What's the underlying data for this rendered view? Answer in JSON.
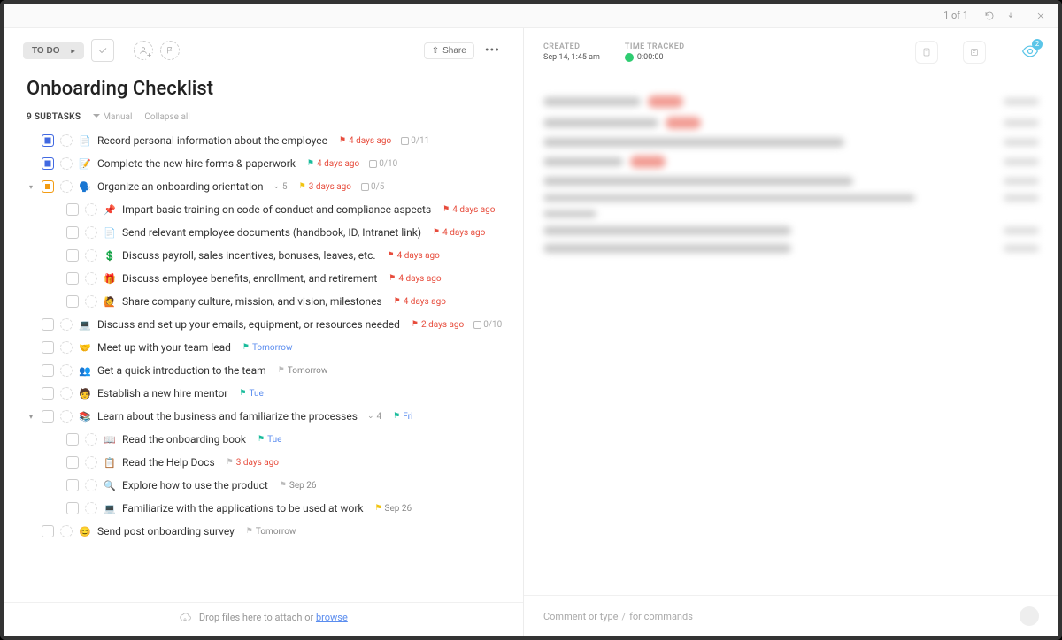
{
  "topbar": {
    "tabs": [
      "",
      "",
      ""
    ],
    "pager": "1 of 1"
  },
  "toolbar": {
    "status": "TO DO",
    "share": "Share"
  },
  "title": "Onboarding Checklist",
  "subtasks_header": {
    "count": "9 SUBTASKS",
    "manual": "Manual",
    "collapse": "Collapse all"
  },
  "tasks": [
    {
      "id": 0,
      "chk": "blue",
      "emoji": "📄",
      "title": "Record personal information about the employee",
      "flag": "red",
      "due": "4 days ago",
      "dueColor": "red",
      "progress": "0/11"
    },
    {
      "id": 1,
      "chk": "blue",
      "emoji": "📝",
      "title": "Complete the new hire forms & paperwork",
      "flag": "teal",
      "due": "4 days ago",
      "dueColor": "red",
      "progress": "0/10"
    },
    {
      "id": 2,
      "chk": "orange",
      "emoji": "🗣️",
      "title": "Organize an onboarding orientation",
      "subCount": 5,
      "flag": "yellow",
      "due": "3 days ago",
      "dueColor": "red",
      "progress": "0/5",
      "collapse": true
    },
    {
      "id": 3,
      "child": true,
      "emoji": "📌",
      "title": "Impart basic training on code of conduct and compliance aspects",
      "flag": "red",
      "due": "4 days ago",
      "dueColor": "red"
    },
    {
      "id": 4,
      "child": true,
      "emoji": "📄",
      "title": "Send relevant employee documents (handbook, ID, Intranet link)",
      "flag": "red",
      "due": "4 days ago",
      "dueColor": "red"
    },
    {
      "id": 5,
      "child": true,
      "emoji": "💲",
      "title": "Discuss payroll, sales incentives, bonuses, leaves, etc.",
      "flag": "red",
      "due": "4 days ago",
      "dueColor": "red"
    },
    {
      "id": 6,
      "child": true,
      "emoji": "🎁",
      "title": "Discuss employee benefits, enrollment, and retirement",
      "flag": "red",
      "due": "4 days ago",
      "dueColor": "red"
    },
    {
      "id": 7,
      "child": true,
      "emoji": "🙋",
      "title": "Share company culture, mission, and vision, milestones",
      "flag": "red",
      "due": "4 days ago",
      "dueColor": "red"
    },
    {
      "id": 8,
      "emoji": "💻",
      "title": "Discuss and set up your emails, equipment, or resources needed",
      "flag": "red",
      "due": "2 days ago",
      "dueColor": "red",
      "progress": "0/10"
    },
    {
      "id": 9,
      "emoji": "🤝",
      "title": "Meet up with your team lead",
      "flag": "teal",
      "due": "Tomorrow",
      "dueColor": "blue"
    },
    {
      "id": 10,
      "emoji": "👥",
      "title": "Get a quick introduction to the team",
      "flag": "grey",
      "due": "Tomorrow",
      "dueColor": "grey"
    },
    {
      "id": 11,
      "emoji": "🧑",
      "title": "Establish a new hire mentor",
      "flag": "teal",
      "due": "Tue",
      "dueColor": "blue"
    },
    {
      "id": 12,
      "emoji": "📚",
      "title": "Learn about the business and familiarize the processes",
      "subCount": 4,
      "flag": "teal",
      "due": "Fri",
      "dueColor": "blue",
      "collapse": true
    },
    {
      "id": 13,
      "child": true,
      "emoji": "📖",
      "title": "Read the onboarding book",
      "flag": "teal",
      "due": "Tue",
      "dueColor": "blue"
    },
    {
      "id": 14,
      "child": true,
      "emoji": "📋",
      "title": "Read the Help Docs",
      "flag": "grey",
      "due": "3 days ago",
      "dueColor": "red"
    },
    {
      "id": 15,
      "child": true,
      "emoji": "🔍",
      "title": "Explore how to use the product",
      "flag": "grey",
      "due": "Sep 26",
      "dueColor": "grey"
    },
    {
      "id": 16,
      "child": true,
      "emoji": "💻",
      "title": "Familiarize with the applications to be used at work",
      "flag": "yellow",
      "due": "Sep 26",
      "dueColor": "grey"
    },
    {
      "id": 17,
      "emoji": "😊",
      "title": "Send post onboarding survey",
      "flag": "grey",
      "due": "Tomorrow",
      "dueColor": "grey"
    }
  ],
  "dropzone": {
    "text": "Drop files here to attach or ",
    "link": "browse"
  },
  "right": {
    "created_label": "CREATED",
    "created_value": "Sep 14, 1:45 am",
    "tracked_label": "TIME TRACKED",
    "tracked_value": "0:00:00",
    "watchers": "2"
  },
  "comment": {
    "placeholder1": "Comment or type ",
    "slash": "/",
    "placeholder2": " for commands"
  }
}
